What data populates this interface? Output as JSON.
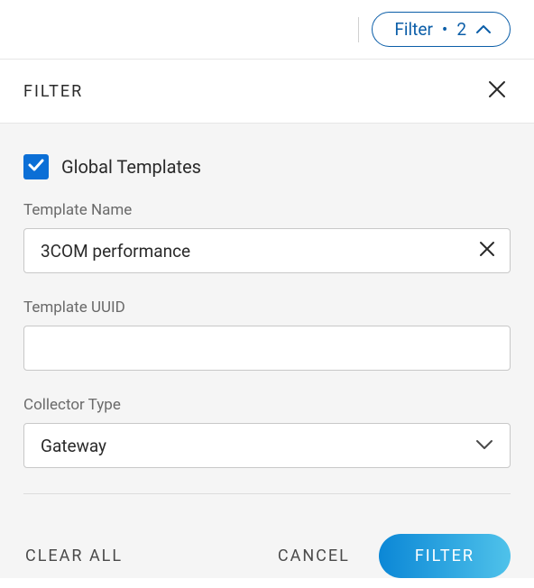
{
  "topbar": {
    "filter_label": "Filter",
    "filter_count": "2",
    "dot": "•"
  },
  "panel": {
    "title": "FILTER"
  },
  "form": {
    "global_templates_label": "Global Templates",
    "global_templates_checked": true,
    "template_name": {
      "label": "Template Name",
      "value": "3COM performance"
    },
    "template_uuid": {
      "label": "Template UUID",
      "value": ""
    },
    "collector_type": {
      "label": "Collector Type",
      "value": "Gateway"
    }
  },
  "footer": {
    "clear_all": "CLEAR ALL",
    "cancel": "CANCEL",
    "filter": "FILTER"
  },
  "colors": {
    "accent": "#0b6fd6",
    "pill_border": "#0b5ea8"
  }
}
